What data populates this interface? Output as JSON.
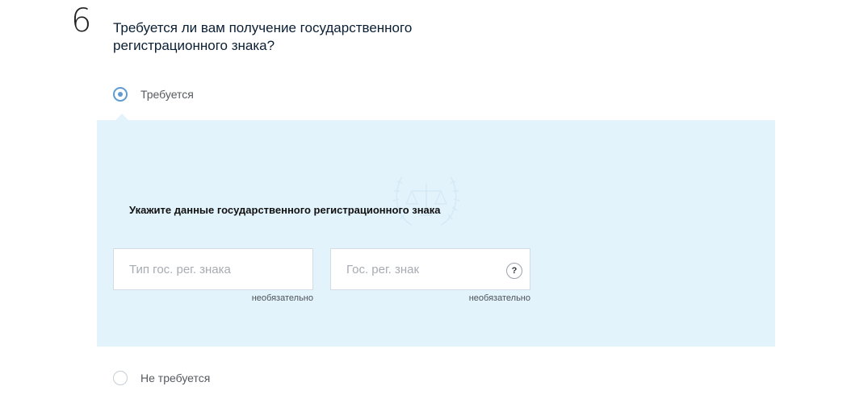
{
  "step": {
    "number": "6"
  },
  "question": {
    "text": "Требуется ли вам получение государственного регистрационного знака?"
  },
  "options": [
    {
      "label": "Требуется",
      "selected": true
    },
    {
      "label": "Не требуется",
      "selected": false
    }
  ],
  "panel": {
    "title": "Укажите данные государственного регистрационного знака",
    "watermark_icon": "scales-laurel-emblem-icon",
    "fields": [
      {
        "value": "",
        "placeholder": "Тип гос. рег. знака",
        "hint": "необязательно"
      },
      {
        "value": "",
        "placeholder": "Гос. рег. знак",
        "hint": "необязательно",
        "help": "?",
        "help_icon": "question-circle-icon"
      }
    ]
  },
  "colors": {
    "accent": "#5e9bd0",
    "panel_background": "#e3f3fc",
    "text": "#0b1f33"
  }
}
